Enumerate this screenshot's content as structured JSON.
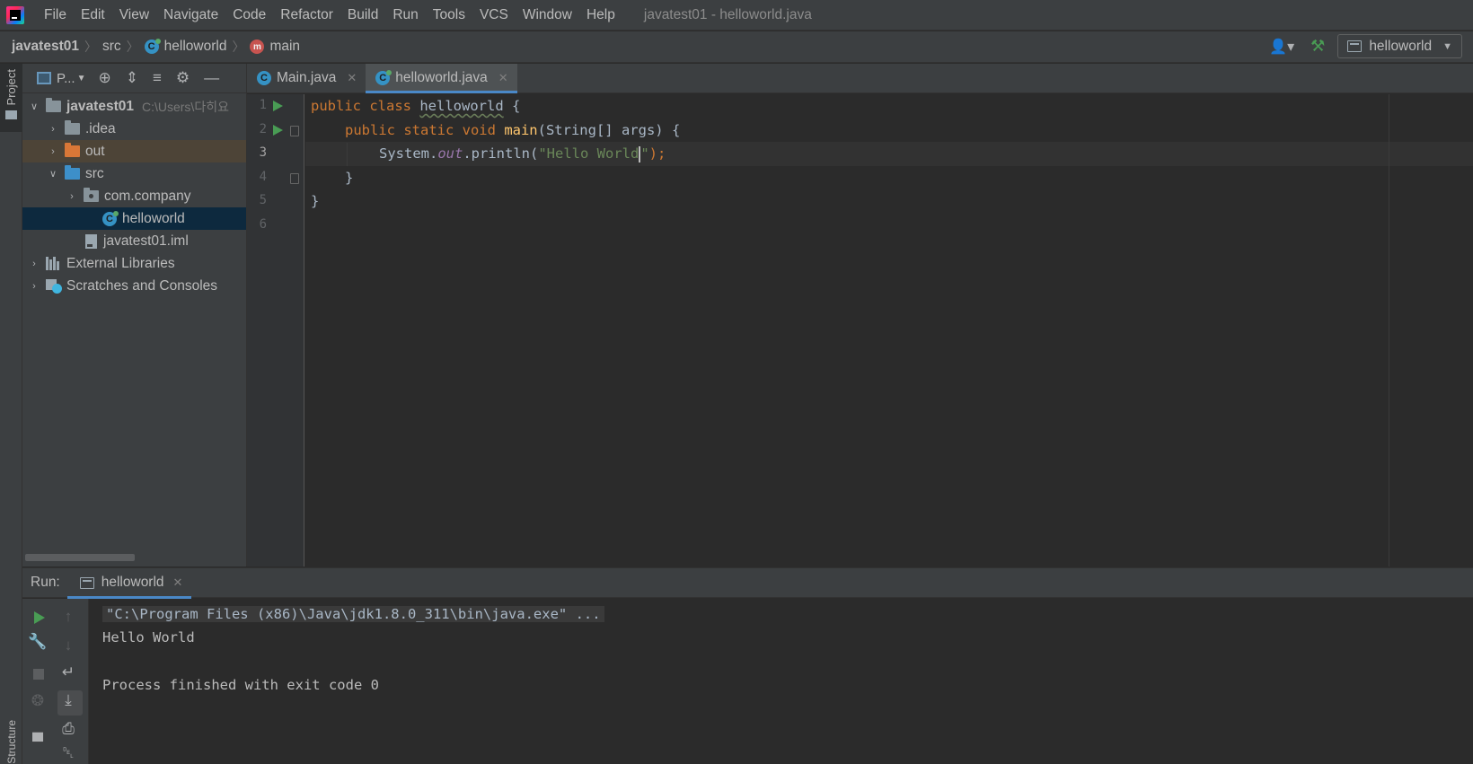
{
  "menubar": {
    "items": [
      {
        "label": "File"
      },
      {
        "label": "Edit"
      },
      {
        "label": "View"
      },
      {
        "label": "Navigate"
      },
      {
        "label": "Code"
      },
      {
        "label": "Refactor"
      },
      {
        "label": "Build"
      },
      {
        "label": "Run"
      },
      {
        "label": "Tools"
      },
      {
        "label": "VCS"
      },
      {
        "label": "Window"
      },
      {
        "label": "Help"
      }
    ],
    "window_title": "javatest01 - helloworld.java"
  },
  "navbar": {
    "crumbs": [
      "javatest01",
      "src",
      "helloworld",
      "main"
    ],
    "run_config": "helloworld"
  },
  "left_stripe": {
    "project_label": "Project",
    "structure_label": "Structure"
  },
  "project_panel": {
    "view_selector": "P...",
    "tree": [
      {
        "label": "javatest01",
        "hint": "C:\\Users\\다히요"
      },
      {
        "label": ".idea"
      },
      {
        "label": "out"
      },
      {
        "label": "src"
      },
      {
        "label": "com.company"
      },
      {
        "label": "helloworld"
      },
      {
        "label": "javatest01.iml"
      },
      {
        "label": "External Libraries"
      },
      {
        "label": "Scratches and Consoles"
      }
    ]
  },
  "editor": {
    "tabs": [
      {
        "label": "Main.java",
        "active": false
      },
      {
        "label": "helloworld.java",
        "active": true
      }
    ],
    "line_numbers": [
      "1",
      "2",
      "3",
      "4",
      "5",
      "6"
    ],
    "code": {
      "l1_kw": "public class ",
      "l1_name": "helloworld",
      "l1_rest": " {",
      "l2_kw": "public static void ",
      "l2_fn": "main",
      "l2_rest": "(String[] args) {",
      "l3_sys": "System.",
      "l3_out": "out",
      "l3_call": ".println(",
      "l3_str_a": "\"Hello World",
      "l3_str_b": "\"",
      "l3_end": ");",
      "l4": "}",
      "l5": "}"
    }
  },
  "run_panel": {
    "label": "Run:",
    "tab": "helloworld",
    "console": [
      "\"C:\\Program Files (x86)\\Java\\jdk1.8.0_311\\bin\\java.exe\" ...",
      "Hello World",
      "",
      "Process finished with exit code 0"
    ]
  },
  "colors": {
    "background": "#2b2b2b",
    "panel": "#3c3f41",
    "keyword": "#cc7832",
    "function": "#ffc66d",
    "string": "#6a8759",
    "field": "#9876aa",
    "accent": "#4a88c7",
    "run_green": "#499c54"
  }
}
